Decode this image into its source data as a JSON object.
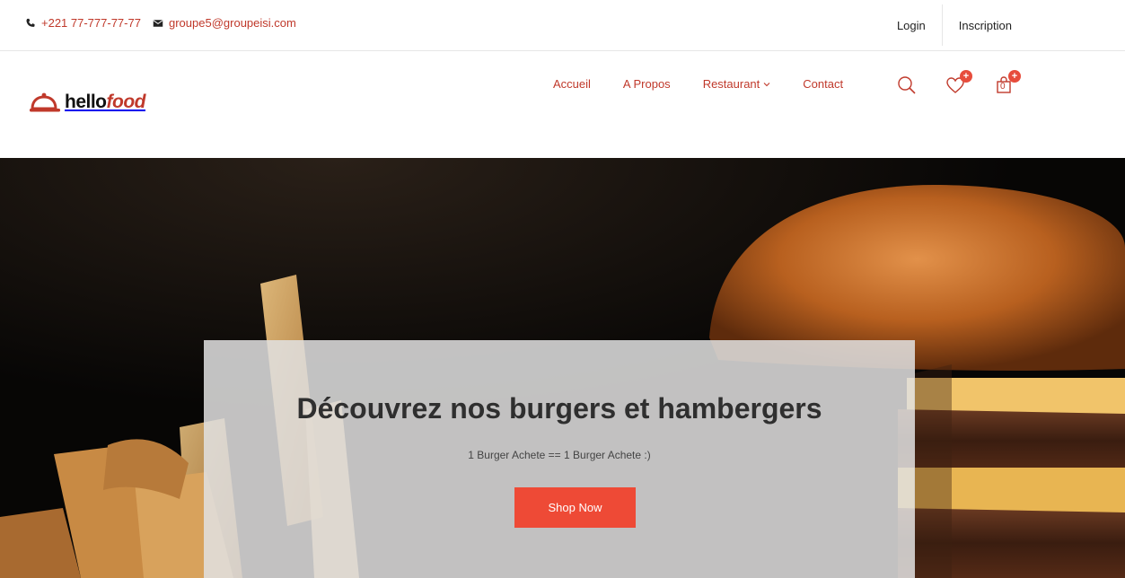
{
  "topbar": {
    "phone": "+221 77-777-77-77",
    "email": "groupe5@groupeisi.com",
    "login_label": "Login",
    "signup_label": "Inscription"
  },
  "header": {
    "logo_hello": "hello",
    "logo_food": "food",
    "nav": {
      "home": "Accueil",
      "about": "A Propos",
      "restaurant": "Restaurant",
      "contact": "Contact"
    },
    "icons": [
      "search-icon",
      "heart-icon",
      "cart-icon"
    ],
    "wishlist_badge": "+",
    "cart_badge": "+",
    "cart_count": "0"
  },
  "hero": {
    "title": "Découvrez nos burgers et hambergers",
    "subtitle": "1 Burger Achete == 1 Burger Achete :)",
    "button_label": "Shop Now"
  },
  "colors": {
    "accent": "#c0392b",
    "button": "#ee4a36",
    "badge": "#e74c3c"
  }
}
